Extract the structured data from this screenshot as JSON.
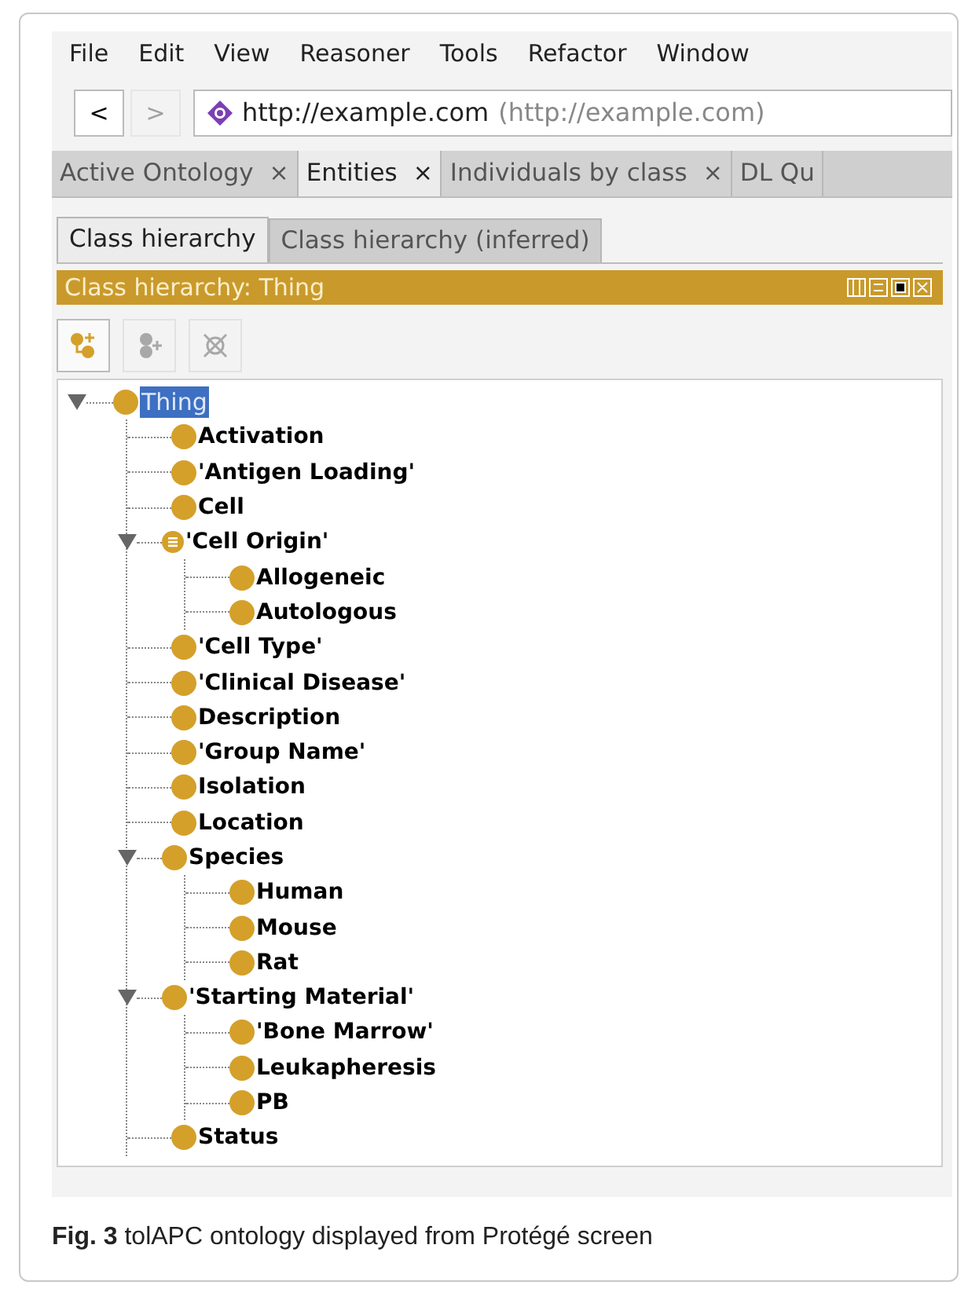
{
  "menu": [
    "File",
    "Edit",
    "View",
    "Reasoner",
    "Tools",
    "Refactor",
    "Window"
  ],
  "nav": {
    "back": {
      "label": "<",
      "disabled": false
    },
    "forward": {
      "label": ">",
      "disabled": true
    },
    "address": "http://example.com",
    "address_note": "(http://example.com)"
  },
  "tabs": [
    {
      "label": "Active Ontology",
      "close": "×",
      "selected": false
    },
    {
      "label": "Entities",
      "close": "×",
      "selected": true
    },
    {
      "label": "Individuals by class",
      "close": "×",
      "selected": false
    },
    {
      "label": "DL Qu",
      "selected": false
    }
  ],
  "subtabs": [
    {
      "label": "Class hierarchy",
      "selected": true
    },
    {
      "label": "Class hierarchy (inferred)",
      "selected": false
    }
  ],
  "panel_title": "Class hierarchy: Thing",
  "toolbar": [
    {
      "kind": "add-subclass",
      "disabled": false
    },
    {
      "kind": "add-sibling",
      "disabled": true
    },
    {
      "kind": "delete",
      "disabled": true
    }
  ],
  "tree": [
    {
      "label": "Thing",
      "selected": true,
      "kind": "class",
      "expanded": true,
      "children": [
        {
          "label": "Activation",
          "selected": false,
          "kind": "class"
        },
        {
          "label": "'Antigen Loading'",
          "selected": false,
          "kind": "class"
        },
        {
          "label": "Cell",
          "selected": false,
          "kind": "class"
        },
        {
          "label": "'Cell Origin'",
          "selected": false,
          "kind": "defined",
          "expanded": true,
          "children": [
            {
              "label": "Allogeneic",
              "selected": false,
              "kind": "class"
            },
            {
              "label": "Autologous",
              "selected": false,
              "kind": "class"
            }
          ]
        },
        {
          "label": "'Cell Type'",
          "selected": false,
          "kind": "class"
        },
        {
          "label": "'Clinical Disease'",
          "selected": false,
          "kind": "class"
        },
        {
          "label": "Description",
          "selected": false,
          "kind": "class"
        },
        {
          "label": "'Group Name'",
          "selected": false,
          "kind": "class"
        },
        {
          "label": "Isolation",
          "selected": false,
          "kind": "class"
        },
        {
          "label": "Location",
          "selected": false,
          "kind": "class"
        },
        {
          "label": "Species",
          "selected": false,
          "kind": "class",
          "expanded": true,
          "children": [
            {
              "label": "Human",
              "selected": false,
              "kind": "class"
            },
            {
              "label": "Mouse",
              "selected": false,
              "kind": "class"
            },
            {
              "label": "Rat",
              "selected": false,
              "kind": "class"
            }
          ]
        },
        {
          "label": "'Starting Material'",
          "selected": false,
          "kind": "class",
          "expanded": true,
          "children": [
            {
              "label": "'Bone Marrow'",
              "selected": false,
              "kind": "class"
            },
            {
              "label": "Leukapheresis",
              "selected": false,
              "kind": "class"
            },
            {
              "label": "PB",
              "selected": false,
              "kind": "class"
            }
          ]
        },
        {
          "label": "Status",
          "selected": false,
          "kind": "class"
        }
      ]
    }
  ],
  "caption": "**Fig. 3** tolAPC ontology displayed from Protégé screen"
}
